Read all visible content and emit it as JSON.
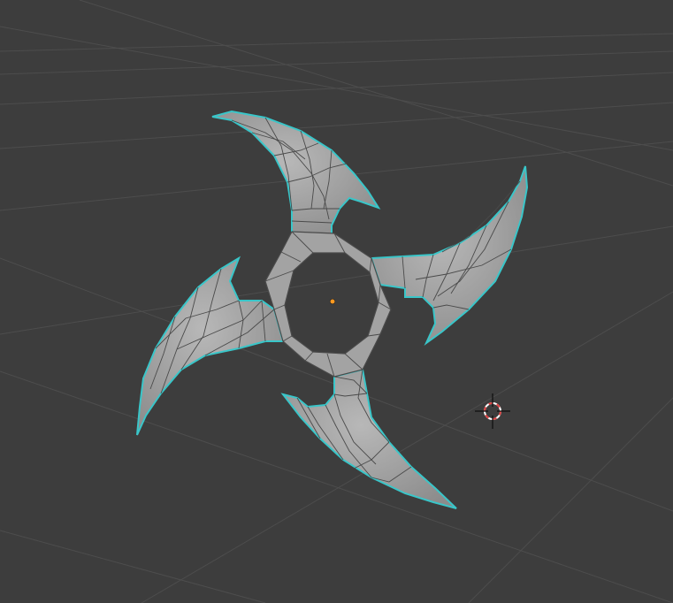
{
  "viewport": {
    "background_color": "#3d3d3d",
    "grid_color": "#4d4d4d",
    "object": {
      "name_icon": "shuriken-mesh",
      "base_color": "#9a9a9a",
      "wire_color": "#3a3a3a",
      "selection_outline_color": "#39c6c9"
    },
    "origin_icon": "object-origin-dot",
    "origin_color": "#ff9a20",
    "cursor_icon": "3d-cursor-icon",
    "cursor_colors": [
      "#e04040",
      "#ffffff"
    ]
  }
}
